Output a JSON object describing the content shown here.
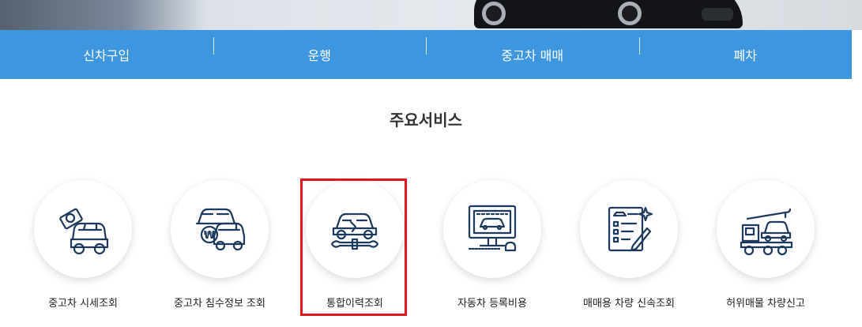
{
  "nav": {
    "items": [
      {
        "label": "신차구입"
      },
      {
        "label": "운행"
      },
      {
        "label": "중고차 매매"
      },
      {
        "label": "폐차"
      }
    ]
  },
  "section": {
    "title": "주요서비스"
  },
  "services": [
    {
      "label": "중고차 시세조회",
      "icon": "car-price-icon"
    },
    {
      "label": "중고차 침수정보 조회",
      "icon": "flooded-car-info-icon"
    },
    {
      "label": "통합이력조회",
      "icon": "car-repair-history-icon"
    },
    {
      "label": "자동차 등록비용",
      "icon": "registration-cost-monitor-icon"
    },
    {
      "label": "매매용 차량 신속조회",
      "icon": "checklist-document-icon"
    },
    {
      "label": "허위매물 차량신고",
      "icon": "tow-truck-report-icon"
    }
  ],
  "colors": {
    "nav_bg": "#3d96de",
    "icon_stroke": "#1d3a5c",
    "highlight": "#e3141b"
  }
}
